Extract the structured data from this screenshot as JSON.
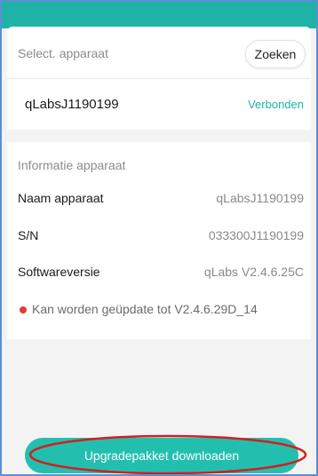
{
  "colors": {
    "accent": "#1fb3a5",
    "button": "#23bfae",
    "status_dot": "#e23b3b",
    "annotation": "#d11f1f"
  },
  "device_select": {
    "label": "Select. apparaat",
    "search_button": "Zoeken",
    "device_name": "qLabsJ1190199",
    "status": "Verbonden"
  },
  "info": {
    "header": "Informatie apparaat",
    "rows": [
      {
        "key": "Naam apparaat",
        "value": "qLabsJ1190199"
      },
      {
        "key": "S/N",
        "value": "033300J1190199"
      },
      {
        "key": "Softwareversie",
        "value": "qLabs V2.4.6.25C"
      }
    ],
    "update_notice": "Kan worden geüpdate tot V2.4.6.29D_14",
    "update_icon": "red-dot-icon"
  },
  "actions": {
    "download_button": "Upgradepakket downloaden"
  }
}
